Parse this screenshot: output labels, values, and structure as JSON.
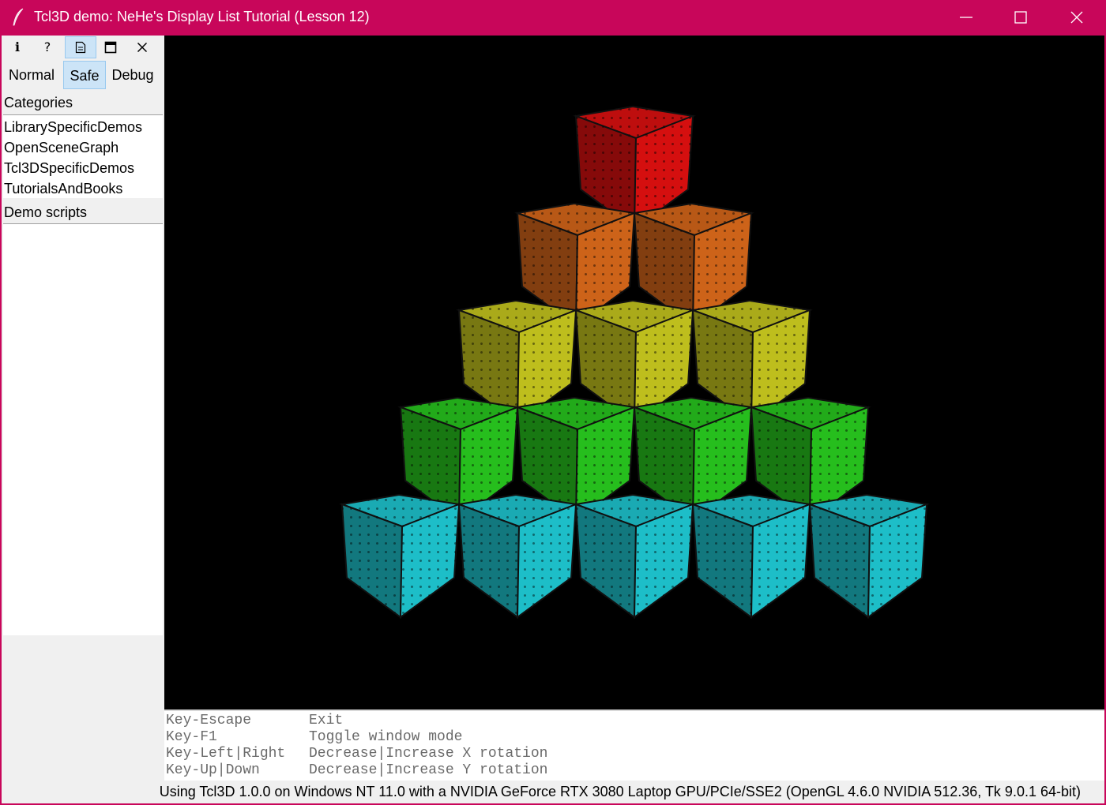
{
  "window": {
    "title": "Tcl3D demo: NeHe's Display List Tutorial (Lesson 12)"
  },
  "toolbar": {
    "info_glyph": "i",
    "help_glyph": "?"
  },
  "modes": {
    "items": [
      "Normal",
      "Safe",
      "Debug"
    ],
    "selected": "Safe"
  },
  "categories": {
    "label": "Categories",
    "items": [
      "LibrarySpecificDemos",
      "OpenSceneGraph",
      "Tcl3DSpecificDemos",
      "TutorialsAndBooks"
    ]
  },
  "demo_scripts": {
    "label": "Demo scripts",
    "items": []
  },
  "scene": {
    "background": "#000000",
    "row_colors": [
      "#e01010",
      "#d8681a",
      "#c8c81e",
      "#28c81e",
      "#1ec8d2"
    ],
    "row_counts": [
      1,
      2,
      3,
      4,
      5
    ]
  },
  "help": {
    "rows": [
      {
        "key": "Key-Escape",
        "desc": "Exit"
      },
      {
        "key": "Key-F1",
        "desc": "Toggle window mode"
      },
      {
        "key": "Key-Left|Right",
        "desc": "Decrease|Increase X rotation"
      },
      {
        "key": "Key-Up|Down",
        "desc": "Decrease|Increase Y rotation"
      }
    ]
  },
  "status": {
    "text": "Using Tcl3D 1.0.0 on Windows NT 11.0 with a NVIDIA GeForce RTX 3080 Laptop GPU/PCIe/SSE2 (OpenGL 4.6.0 NVIDIA 512.36, Tk 9.0.1 64-bit)"
  }
}
